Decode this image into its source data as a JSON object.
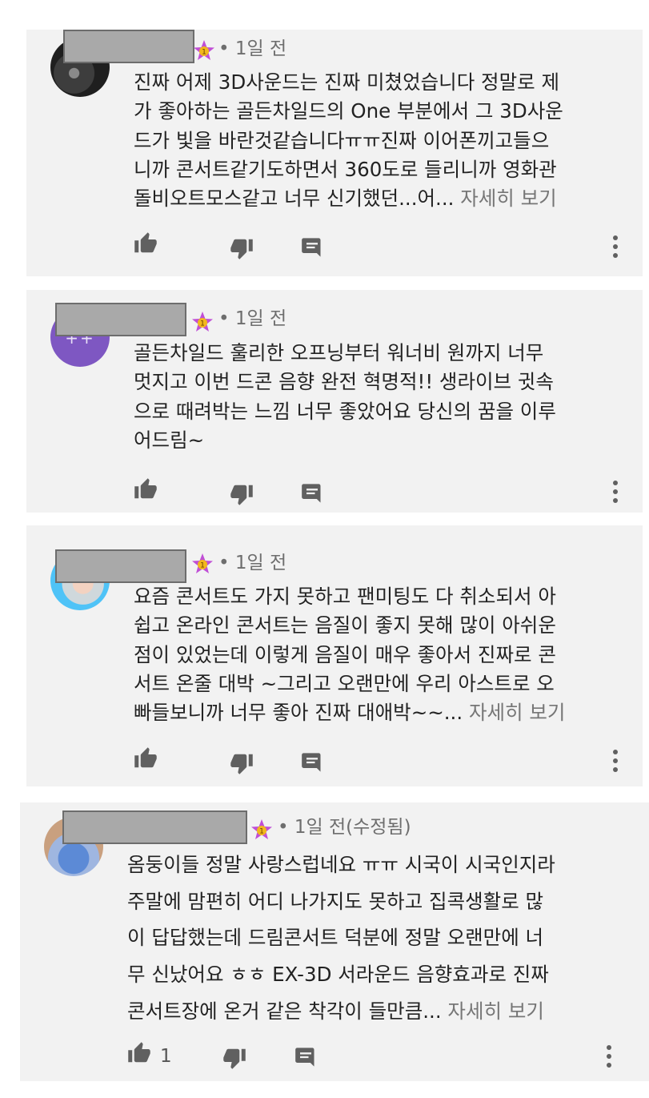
{
  "comments": [
    {
      "time": "• 1일 전",
      "lines": [
        "진짜 어제 3D사운드는 진짜 미쳤었습니다 정말로 제",
        "가 좋아하는 골든차일드의 One 부분에서 그 3D사운",
        "드가 빛을 바란것같습니다ㅠㅠ진짜 이어폰끼고들으",
        "니까 콘서트같기도하면서 360도로 들리니까 영화관"
      ],
      "last_line": "돌비오트모스같고 너무 신기했던...어...",
      "more": "자세히 보기",
      "like_count": ""
    },
    {
      "time": "• 1일 전",
      "lines": [
        "골든차일드 훌리한 오프닝부터 워너비 원까지 너무",
        "멋지고 이번 드콘 음향 완전 혁명적!! 생라이브 귓속",
        "으로 때려박는 느낌 너무 좋았어요 당신의 꿈을 이루"
      ],
      "last_line": "어드림~",
      "more": "",
      "like_count": ""
    },
    {
      "time": "• 1일 전",
      "lines": [
        "요즘 콘서트도 가지 못하고 팬미팅도 다 취소되서 아",
        "쉽고 온라인 콘서트는 음질이 좋지 못해 많이 아쉬운",
        "점이 있었는데 이렇게 음질이 매우 좋아서 진짜로 콘",
        "서트 온줄 대박 ~그리고 오랜만에 우리 아스트로 오"
      ],
      "last_line": "빠들보니까 너무 좋아 진짜 대애박~~...",
      "more": "자세히 보기",
      "like_count": ""
    },
    {
      "time": "• 1일 전(수정됨)",
      "lines": [
        "옴둥이들 정말 사랑스럽네요 ㅠㅠ 시국이 시국인지라",
        "주말에 맘편히 어디 나가지도 못하고 집콕생활로 많",
        "이 답답했는데 드림콘서트 덕분에 정말 오랜만에 너",
        "무 신났어요 ㅎㅎ EX-3D 서라운드 음향효과로 진짜"
      ],
      "last_line": "콘서트장에 온거 같은 착각이 들만큼...",
      "more": "자세히 보기",
      "like_count": "1"
    }
  ],
  "icons": {
    "like": "thumb-up-icon",
    "dislike": "thumb-down-icon",
    "reply": "reply-comment-icon",
    "menu": "more-vert-icon",
    "badge": "level-star-badge-icon"
  },
  "badge_text": "1",
  "colors": {
    "card_bg": "#f2f2f2",
    "avatar_purple": "#7e57c2",
    "badge_star": "#c04fd6",
    "badge_gold": "#f2b81c",
    "icon": "#606060"
  }
}
